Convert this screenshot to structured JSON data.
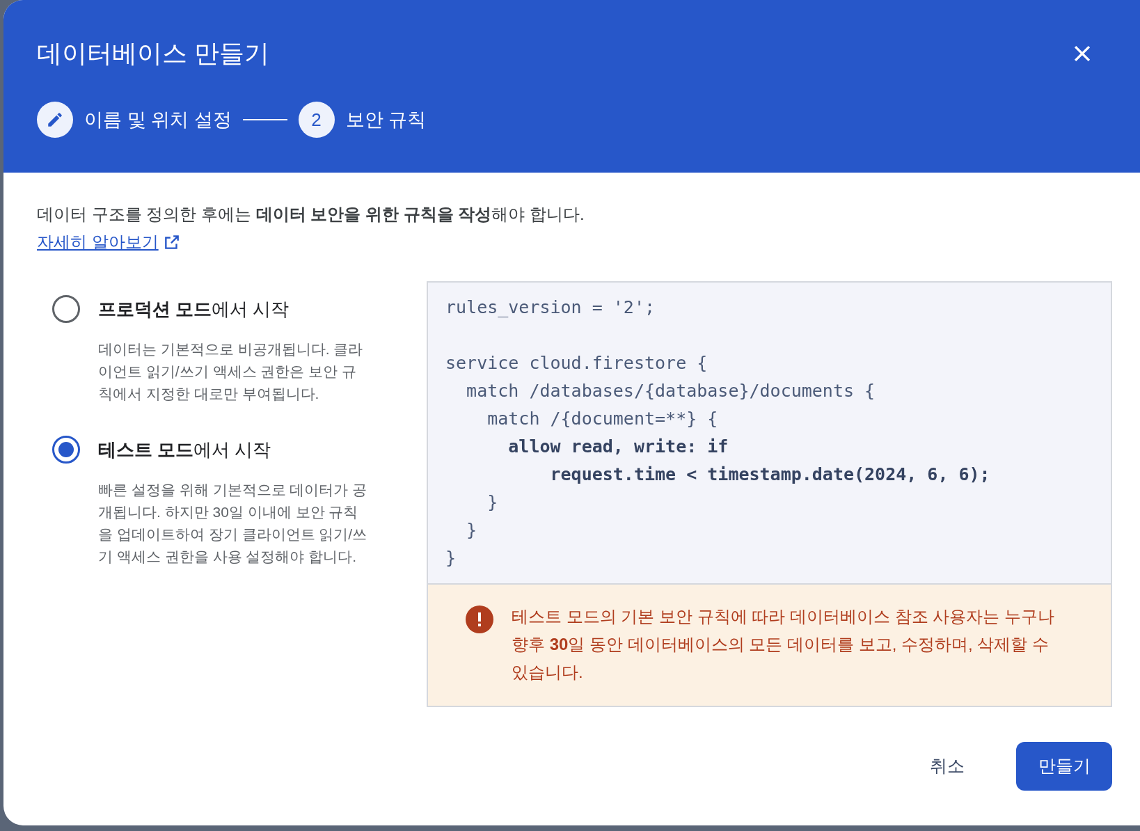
{
  "dialog": {
    "title": "데이터베이스 만들기",
    "steps": [
      {
        "label": "이름 및 위치 설정",
        "kind": "done"
      },
      {
        "number": "2",
        "label": "보안 규칙",
        "kind": "current"
      }
    ]
  },
  "intro": {
    "text": "데이터 구조를 정의한 후에는 **데이터 보안을 위한 규칙을 작성**해야 합니다.",
    "link": "자세히 알아보기"
  },
  "modes": [
    {
      "title": "**프로덕션 모드**에서 시작",
      "description": "데이터는 기본적으로 비공개됩니다. 클라이언트 읽기/쓰기 액세스 권한은 보안 규칙에서 지정한 대로만 부여됩니다.",
      "selected": false
    },
    {
      "title": "**테스트 모드**에서 시작",
      "description": "빠른 설정을 위해 기본적으로 데이터가 공개됩니다. 하지만 30일 이내에 보안 규칙을 업데이트하여 장기 클라이언트 읽기/쓰기 액세스 권한을 사용 설정해야 합니다.",
      "selected": true
    }
  ],
  "code": [
    [
      {
        "text": "rules_version = '2';",
        "bold": false
      }
    ],
    [
      {
        "text": "service cloud.firestore {",
        "bold": false
      },
      {
        "text": "  match /databases/{database}/documents {",
        "bold": false
      },
      {
        "text": "    match /{document=**} {",
        "bold": false
      },
      {
        "text": "      allow read, write: if",
        "bold": true
      },
      {
        "text": "          request.time < timestamp.date(2024, 6, 6);",
        "bold": true
      },
      {
        "text": "    }",
        "bold": false
      },
      {
        "text": "  }",
        "bold": false
      },
      {
        "text": "}",
        "bold": false
      }
    ]
  ],
  "warning": "테스트 모드의 기본 보안 규칙에 따라 데이터베이스 참조 사용자는 누구나 향후 **30**일 동안 데이터베이스의 모든 데이터를 보고, 수정하며, 삭제할 수 있습니다.",
  "buttons": [
    {
      "label": "취소",
      "kind": "text"
    },
    {
      "label": "만들기",
      "kind": "primary"
    }
  ]
}
